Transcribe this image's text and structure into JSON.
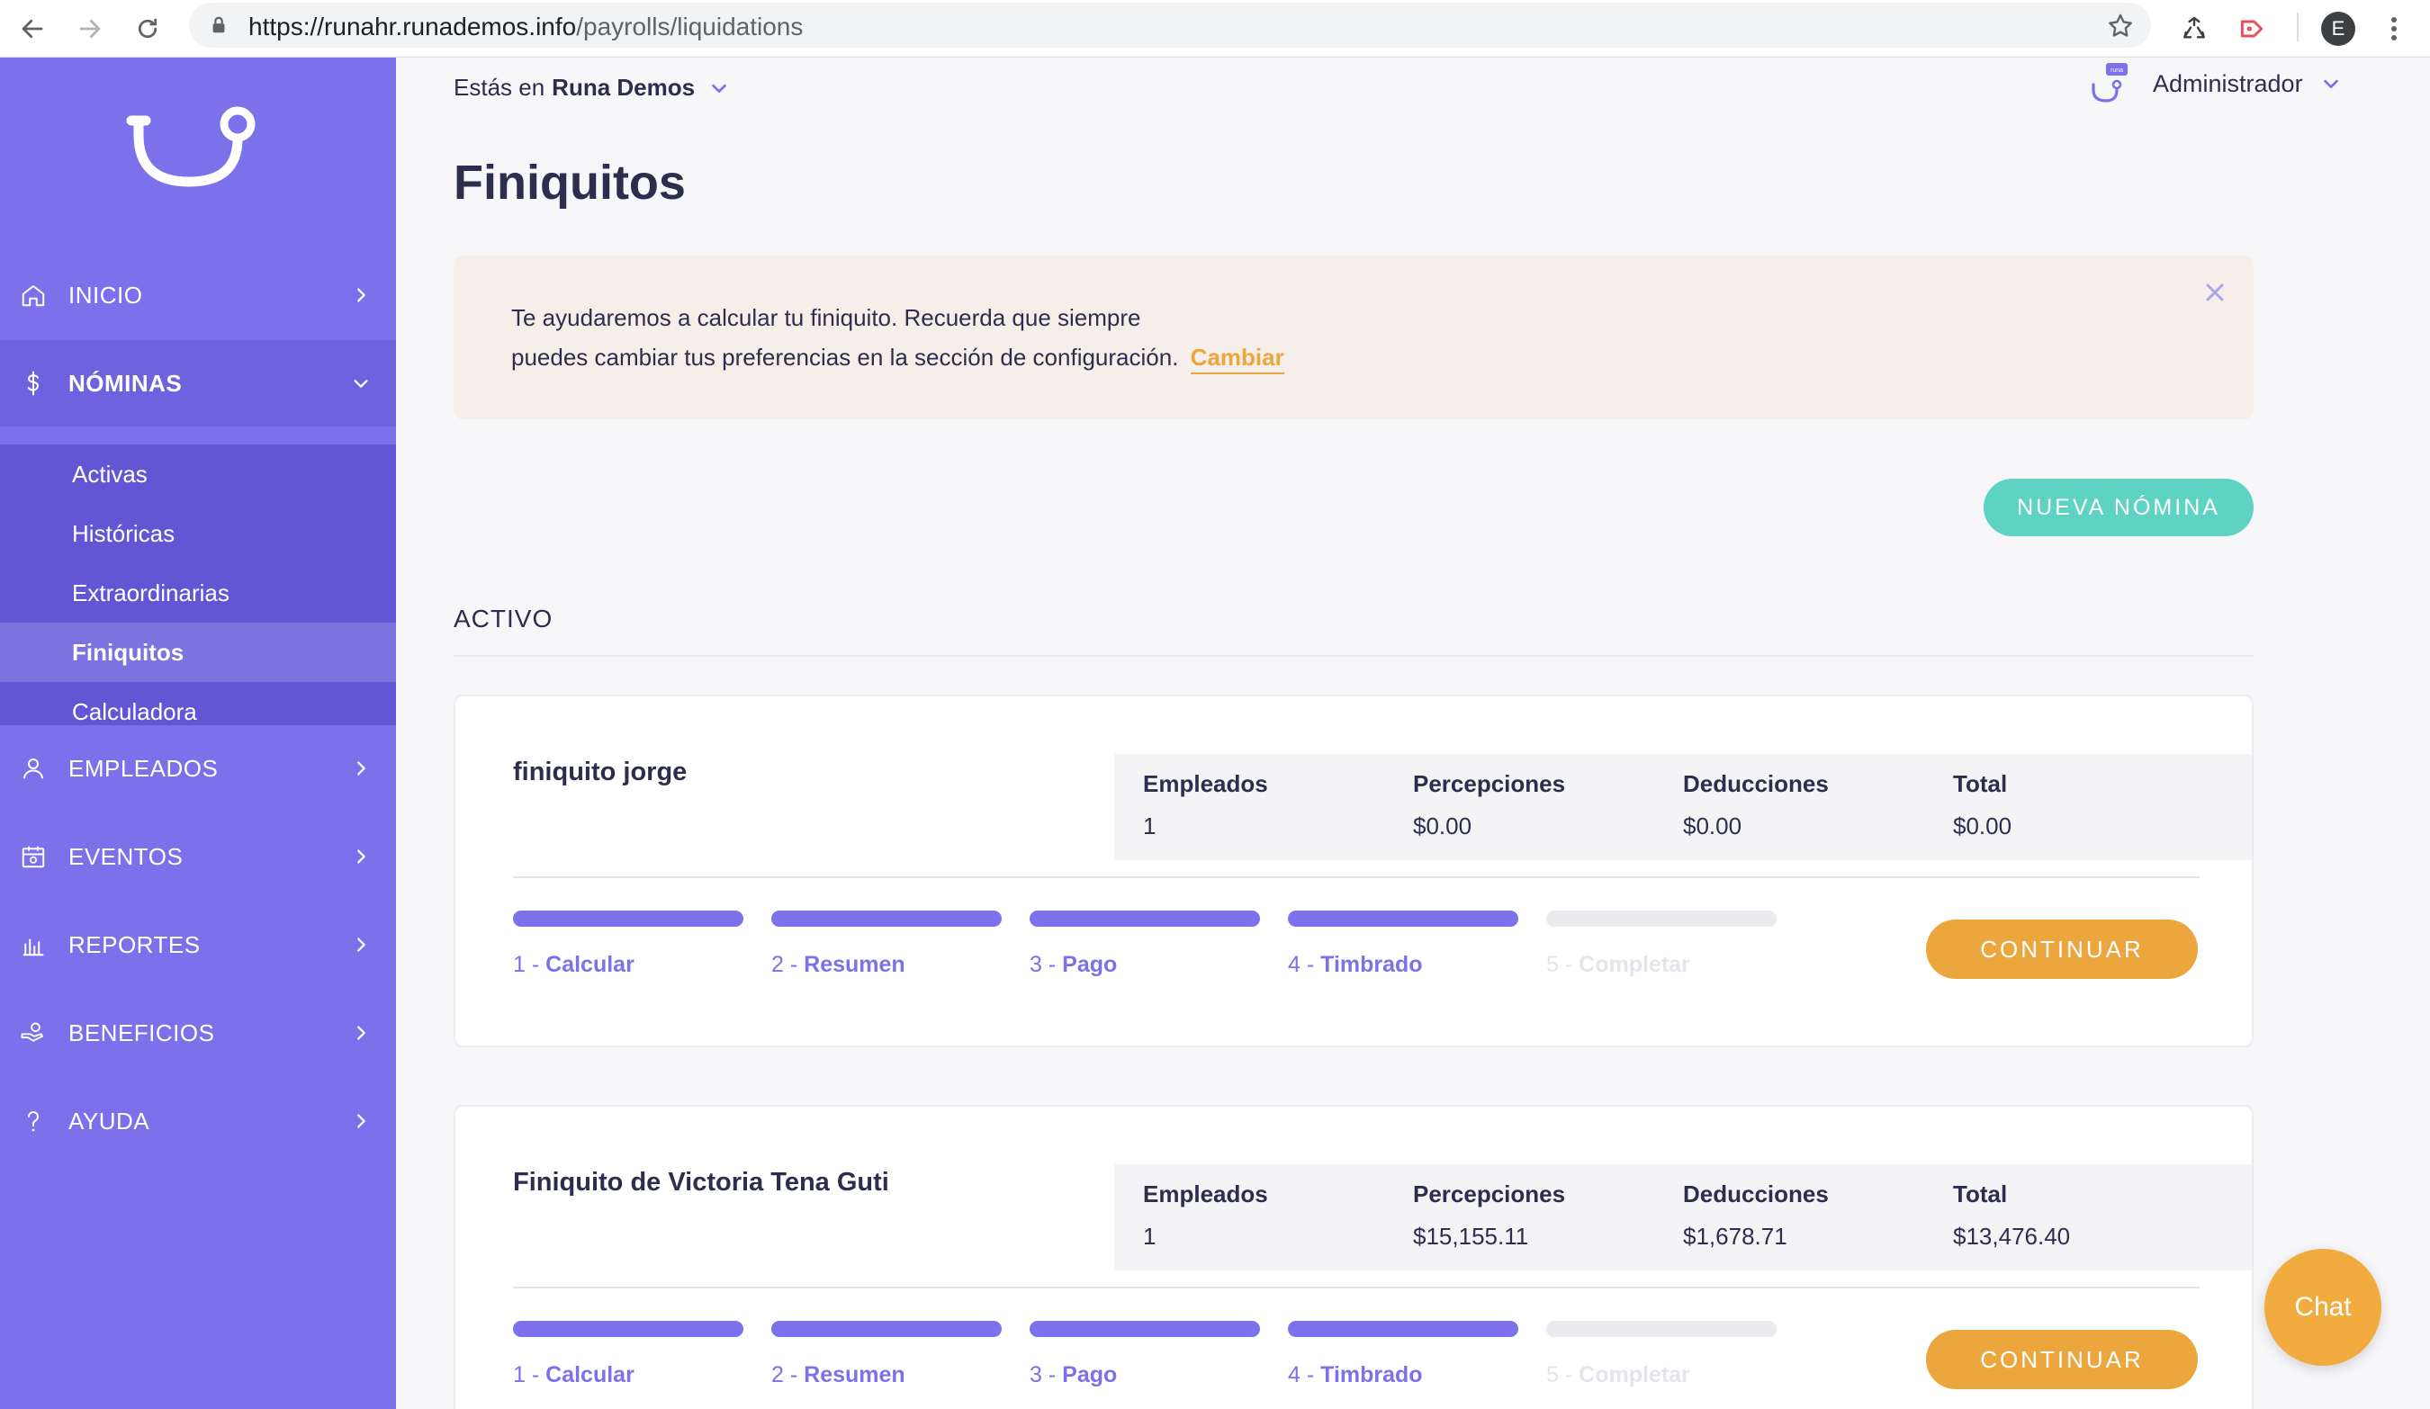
{
  "browser": {
    "url_host": "https://runahr.runademos.info",
    "url_path": "/payrolls/liquidations",
    "profile_initial": "E"
  },
  "sidebar": {
    "items": [
      {
        "label": "INICIO",
        "icon": "home-icon"
      },
      {
        "label": "NÓMINAS",
        "icon": "dollar-icon"
      },
      {
        "label": "EMPLEADOS",
        "icon": "user-icon"
      },
      {
        "label": "EVENTOS",
        "icon": "calendar-icon"
      },
      {
        "label": "REPORTES",
        "icon": "bar-chart-icon"
      },
      {
        "label": "BENEFICIOS",
        "icon": "hand-coin-icon"
      },
      {
        "label": "AYUDA",
        "icon": "question-icon"
      }
    ],
    "nominas_sub": [
      "Activas",
      "Históricas",
      "Extraordinarias",
      "Finiquitos",
      "Calculadora"
    ]
  },
  "topbar": {
    "context_prefix": "Estás en",
    "company": "Runa Demos",
    "user": "Administrador"
  },
  "page": {
    "title": "Finiquitos",
    "banner": {
      "line1": "Te ayudaremos a calcular tu finiquito. Recuerda que siempre",
      "line2": "puedes cambiar tus preferencias en la sección de configuración.",
      "link": "Cambiar"
    },
    "new_button": "NUEVA NÓMINA",
    "section": "ACTIVO",
    "stat_labels": [
      "Empleados",
      "Percepciones",
      "Deducciones",
      "Total"
    ],
    "steps": [
      {
        "num": "1 -",
        "name": "Calcular"
      },
      {
        "num": "2 -",
        "name": "Resumen"
      },
      {
        "num": "3 -",
        "name": "Pago"
      },
      {
        "num": "4 -",
        "name": "Timbrado"
      },
      {
        "num": "5 -",
        "name": "Completar"
      }
    ],
    "continue_label": "CONTINUAR",
    "cards": [
      {
        "name": "finiquito jorge",
        "values": [
          "1",
          "$0.00",
          "$0.00",
          "$0.00"
        ],
        "steps_complete": 4
      },
      {
        "name": "Finiquito de Victoria Tena Guti",
        "values": [
          "1",
          "$15,155.11",
          "$1,678.71",
          "$13,476.40"
        ],
        "steps_complete": 4
      }
    ]
  },
  "chat_label": "Chat",
  "colors": {
    "brand": "#7b71ea",
    "accent_orange": "#eba63e",
    "accent_teal": "#5fd3c3"
  }
}
